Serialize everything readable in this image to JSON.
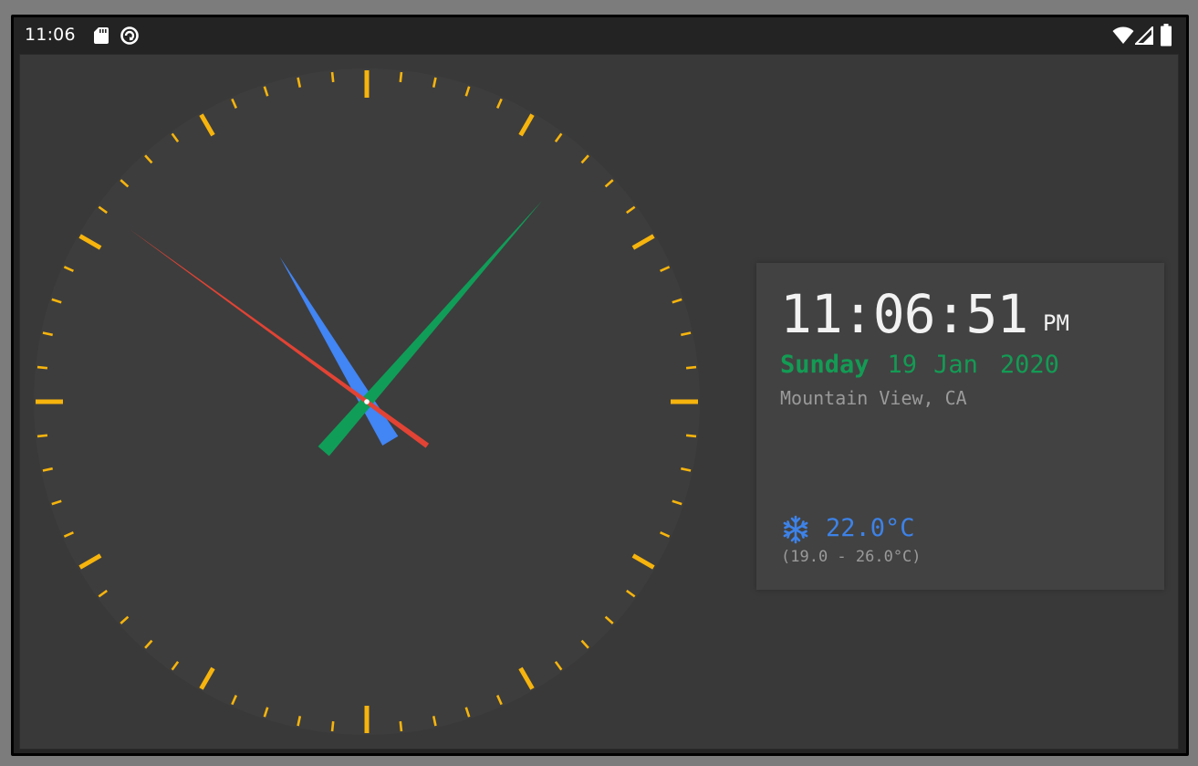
{
  "status_bar": {
    "time": "11:06",
    "left_icons": [
      "sd-card-icon",
      "sync-icon"
    ],
    "right_icons": [
      "wifi-icon",
      "signal-icon",
      "battery-icon"
    ]
  },
  "analog_clock": {
    "hours": 11,
    "minutes": 6,
    "seconds": 51,
    "colors": {
      "ticks": "#f6b40d",
      "face": "#3d3d3d",
      "hour_hand": "#4285f4",
      "minute_hand": "#109d58",
      "second_hand": "#e24334"
    }
  },
  "info_card": {
    "time": "11:06:51",
    "ampm": "PM",
    "weekday": "Sunday",
    "day": "19",
    "month": "Jan",
    "year": "2020",
    "location": "Mountain View, CA",
    "weather_icon": "snowflake-icon",
    "temperature": "22.0°C",
    "temperature_range": "(19.0 - 26.0°C)",
    "colors": {
      "date": "#139b54",
      "temperature": "#3d82e8",
      "muted": "#9a9a9a"
    }
  }
}
